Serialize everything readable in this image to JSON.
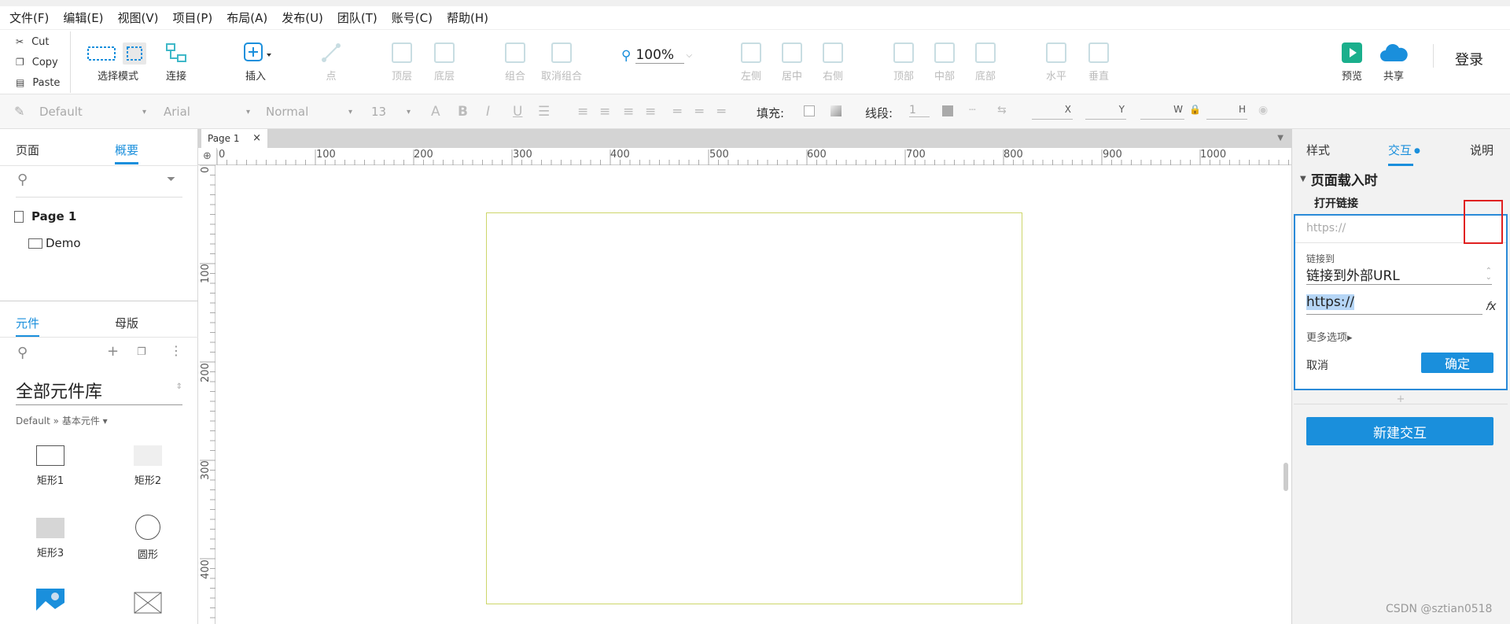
{
  "menubar": {
    "items": [
      "文件(F)",
      "编辑(E)",
      "视图(V)",
      "项目(P)",
      "布局(A)",
      "发布(U)",
      "团队(T)",
      "账号(C)",
      "帮助(H)"
    ]
  },
  "toolbar": {
    "cut": "Cut",
    "copy": "Copy",
    "paste": "Paste",
    "select_mode": "选择模式",
    "connect": "连接",
    "insert": "插入",
    "point": "点",
    "top_layer": "顶层",
    "bottom_layer": "底层",
    "group": "组合",
    "ungroup": "取消组合",
    "zoom": "100%",
    "align_left": "左侧",
    "align_center": "居中",
    "align_right": "右侧",
    "align_top": "顶部",
    "align_middle": "中部",
    "align_bottom": "底部",
    "dist_horizontal": "水平",
    "dist_vertical": "垂直",
    "preview": "预览",
    "share": "共享",
    "login": "登录"
  },
  "format": {
    "style": "Default",
    "font": "Arial",
    "weight": "Normal",
    "size": "13",
    "fill_label": "填充:",
    "stroke_label": "线段:",
    "stroke_value": "1",
    "x": "X",
    "y": "Y",
    "w": "W",
    "h": "H"
  },
  "left": {
    "tab_pages": "页面",
    "tab_outline": "概要",
    "page_name": "Page 1",
    "child_name": "Demo",
    "tab_widgets": "元件",
    "tab_masters": "母版",
    "library": "全部元件库",
    "breadcrumb": "Default » 基本元件 ▾",
    "widgets": [
      "矩形1",
      "矩形2",
      "矩形3",
      "圆形"
    ]
  },
  "canvas": {
    "page_tab": "Page 1",
    "hruler": [
      "0",
      "100",
      "200",
      "300",
      "400",
      "500",
      "600",
      "700",
      "800",
      "900",
      "1000"
    ],
    "vruler": [
      "0",
      "100",
      "200",
      "300",
      "400"
    ]
  },
  "right": {
    "tab_style": "样式",
    "tab_interaction": "交互",
    "tab_notes": "说明",
    "event": "页面载入时",
    "action": "打开链接",
    "url_placeholder": "https://",
    "link_to_label": "链接到",
    "link_to_value": "链接到外部URL",
    "url_value": "https://",
    "more_options": "更多选项▸",
    "cancel": "取消",
    "ok": "确定",
    "new_interaction": "新建交互"
  },
  "watermark": "CSDN @sztian0518"
}
